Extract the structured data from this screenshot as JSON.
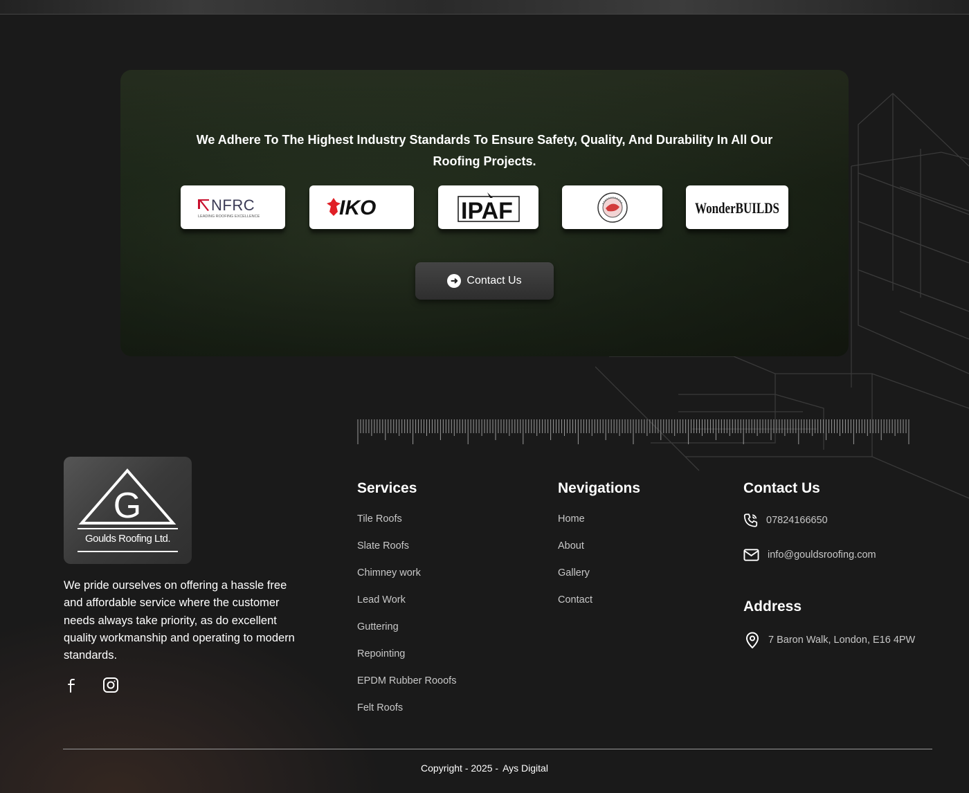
{
  "banner": {
    "heading": "We Adhere To The Highest Industry Standards To Ensure Safety, Quality, And Durability In All Our Roofing Projects.",
    "contact_button": "Contact Us",
    "logos": {
      "nfrc": {
        "name": "NFRC",
        "tagline": "LEADING ROOFING EXCELLENCE"
      },
      "iko": {
        "name": "IKO"
      },
      "ipaf": {
        "name": "IPAF"
      },
      "confederation": {
        "name": "CONFEDERATION OF ROOFING CONTRACTORS"
      },
      "wonderbuilds": {
        "name": "WonderBUILDS"
      }
    }
  },
  "footer": {
    "brand": {
      "letter": "G",
      "name": "Goulds Roofing Ltd."
    },
    "about": "We pride ourselves on offering a hassle free and affordable service where the customer needs always take priority, as do excellent quality workmanship and operating to modern standards.",
    "social": [
      "facebook-icon",
      "instagram-icon"
    ],
    "services": {
      "title": "Services",
      "items": [
        "Tile Roofs",
        "Slate Roofs",
        "Chimney work",
        "Lead Work",
        "Guttering",
        "Repointing",
        "EPDM Rubber Rooofs",
        "Felt Roofs"
      ]
    },
    "navigations": {
      "title": "Nevigations",
      "items": [
        "Home",
        "About",
        "Gallery",
        "Contact"
      ]
    },
    "contact": {
      "title": "Contact Us",
      "phone": "07824166650",
      "email": "info@gouldsroofing.com"
    },
    "address": {
      "title": "Address",
      "line": "7 Baron Walk, London, E16 4PW"
    },
    "copyright": "Copyright - 2025 -",
    "credit": "Ays Digital"
  },
  "colors": {
    "background": "#1a1a1a",
    "text": "#ffffff",
    "muted_text": "#c8c8c8",
    "nfrc_accent": "#c8102e",
    "iko_red": "#e01f26"
  }
}
